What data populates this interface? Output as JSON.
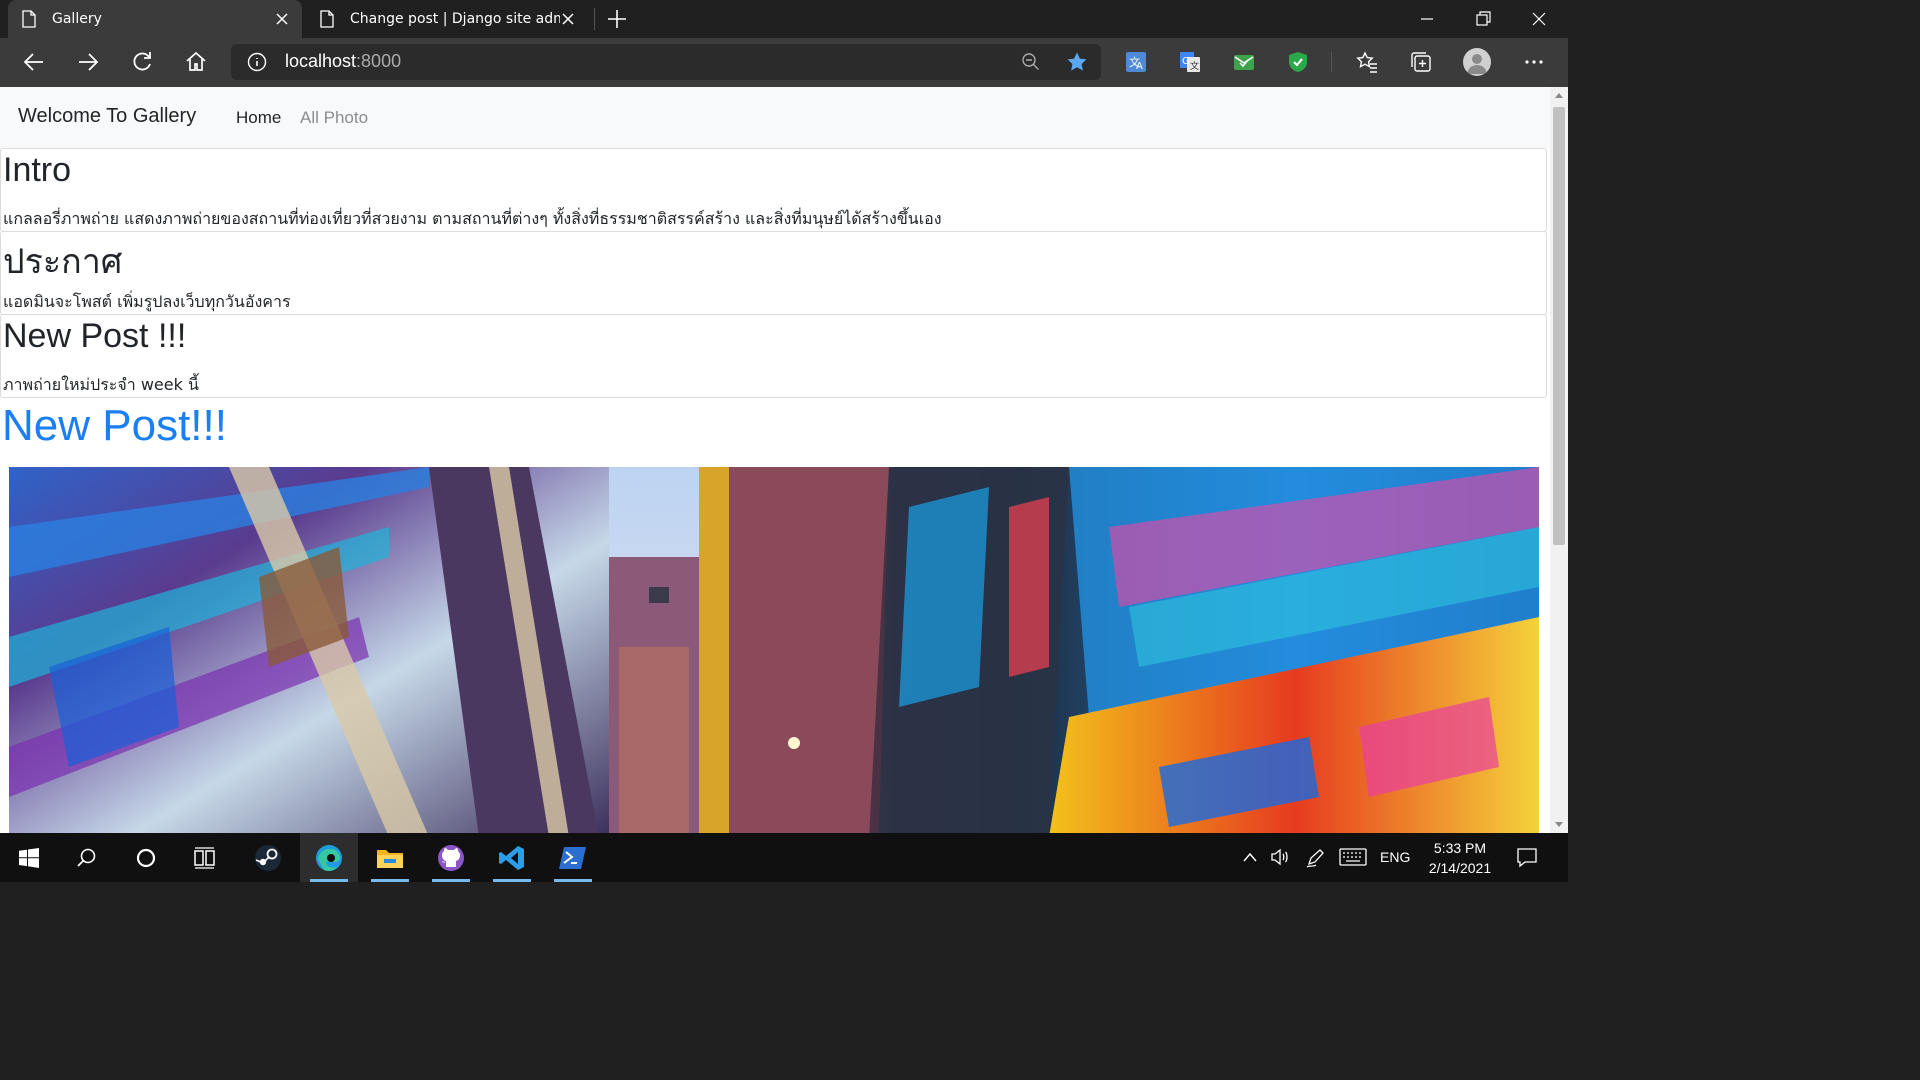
{
  "browser": {
    "tabs": [
      {
        "title": "Gallery",
        "active": true
      },
      {
        "title": "Change post | Django site admin",
        "active": false
      }
    ],
    "url_host": "localhost",
    "url_port": ":8000"
  },
  "site": {
    "brand": "Welcome To Gallery",
    "nav": [
      {
        "label": "Home",
        "active": true
      },
      {
        "label": "All Photo",
        "active": false
      }
    ],
    "cards": [
      {
        "title": "Intro",
        "text": "แกลลอรี่ภาพถ่าย แสดงภาพถ่ายของสถานที่ท่องเที่ยวที่สวยงาม ตามสถานที่ต่างๆ ทั้งสิ่งที่ธรรมชาติสรรค์สร้าง และสิ่งที่มนุษย์ได้สร้างขึ้นเอง"
      },
      {
        "title": "ประกาศ",
        "text": "แอดมินจะโพสต์ เพิ่มรูปลงเว็บทุกวันอังคาร"
      },
      {
        "title": "New Post !!!",
        "text": "ภาพถ่ายใหม่ประจำ week นี้"
      }
    ],
    "new_post_heading": "New Post!!!",
    "photo_icon": "graffiti-alley-photo",
    "link_color": "#1a7ff5"
  },
  "taskbar": {
    "apps": [
      "start-icon",
      "search-icon",
      "cortana-icon",
      "task-view-icon",
      "steam-icon",
      "edge-icon",
      "file-explorer-icon",
      "github-desktop-icon",
      "vscode-icon",
      "powershell-icon"
    ],
    "language": "ENG",
    "time": "5:33 PM",
    "date": "2/14/2021"
  }
}
